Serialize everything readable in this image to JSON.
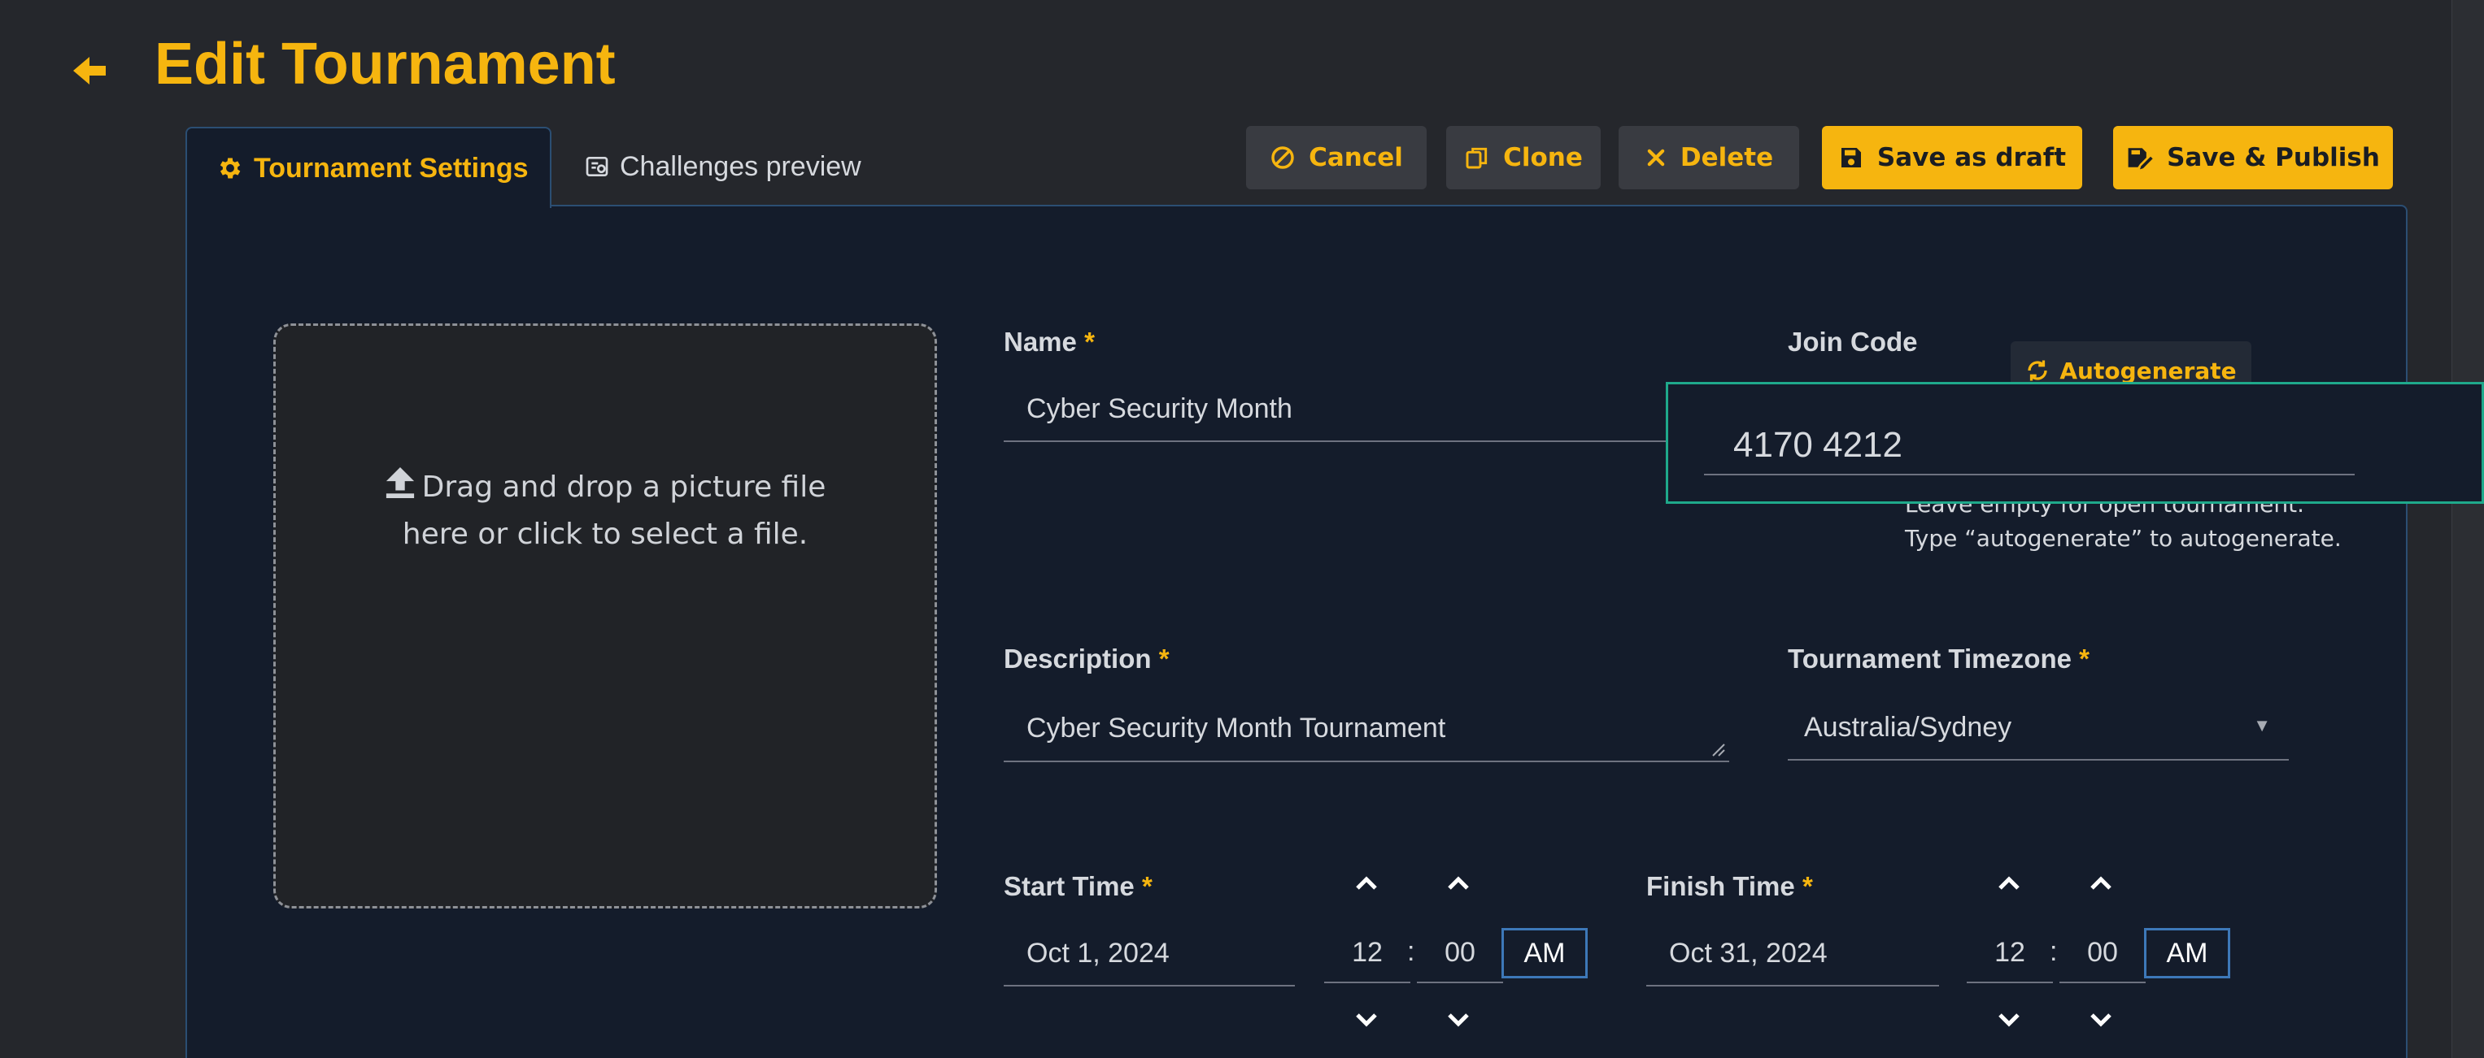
{
  "header": {
    "title": "Edit Tournament",
    "back_icon": "arrow-left-icon"
  },
  "tabs": [
    {
      "label": "Tournament Settings",
      "icon": "gear-icon",
      "active": true
    },
    {
      "label": "Challenges preview",
      "icon": "preview-icon",
      "active": false
    }
  ],
  "toolbar": {
    "cancel": "Cancel",
    "clone": "Clone",
    "delete": "Delete",
    "save_draft": "Save as draft",
    "save_publish": "Save & Publish"
  },
  "dropzone": {
    "line1": "Drag and drop a picture file",
    "line2": "here or click to select a file."
  },
  "form": {
    "name": {
      "label": "Name",
      "required": "*",
      "value": "Cyber Security Month"
    },
    "join_code": {
      "label": "Join Code",
      "value": "4170 4212",
      "autogenerate": "Autogenerate",
      "hint1": "Leave empty for open tournament.",
      "hint2": "Type “autogenerate” to autogenerate."
    },
    "description": {
      "label": "Description",
      "required": "*",
      "value": "Cyber Security Month Tournament"
    },
    "timezone": {
      "label": "Tournament Timezone",
      "required": "*",
      "value": "Australia/Sydney"
    },
    "start": {
      "label": "Start Time",
      "required": "*",
      "date": "Oct 1, 2024",
      "hour": "12",
      "minute": "00",
      "ampm": "AM",
      "sep": ":"
    },
    "finish": {
      "label": "Finish Time",
      "required": "*",
      "date": "Oct 31, 2024",
      "hour": "12",
      "minute": "00",
      "ampm": "AM",
      "sep": ":"
    }
  },
  "colors": {
    "accent": "#f6b50f",
    "panel": "#141c2b",
    "background": "#25272c",
    "focus": "#1fa98b",
    "border": "#2b4e73"
  }
}
